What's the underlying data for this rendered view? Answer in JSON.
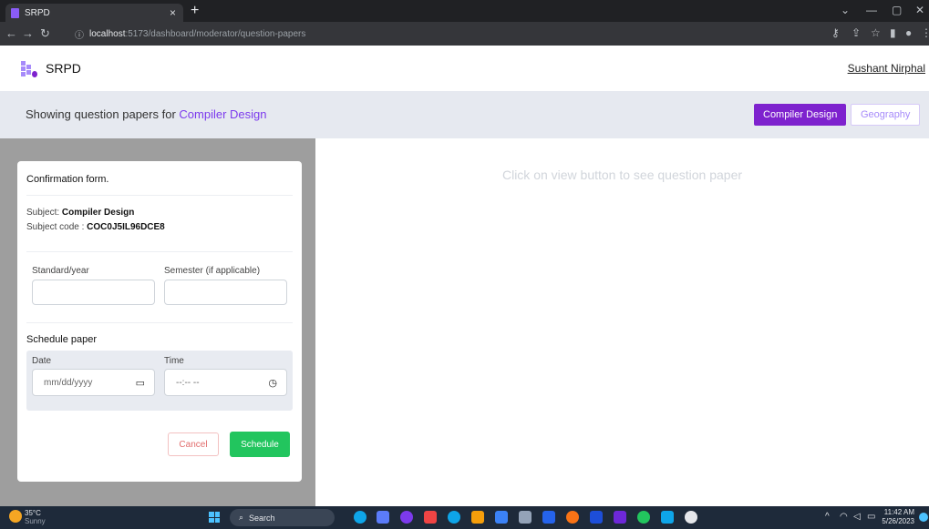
{
  "browser": {
    "tab_title": "SRPD",
    "tab_close": "×",
    "new_tab": "+",
    "url_host": "localhost",
    "url_rest": ":5173/dashboard/moderator/question-papers"
  },
  "app": {
    "brand": "SRPD",
    "user_name": "Sushant Nirphal"
  },
  "subject_bar": {
    "prefix": "Showing question papers for",
    "current_subject": "Compiler Design",
    "subjects": [
      "Compiler Design",
      "Geography"
    ]
  },
  "form": {
    "title": "Confirmation form.",
    "subject_label": "Subject:",
    "subject_value": "Compiler Design",
    "subject_code_label": "Subject code :",
    "subject_code_value": "COC0J5IL96DCE8",
    "standard_label": "Standard/year",
    "semester_label": "Semester (if applicable)",
    "schedule_title": "Schedule paper",
    "date_label": "Date",
    "date_placeholder": "mm/dd/yyyy",
    "time_label": "Time",
    "time_placeholder": "--:-- --",
    "cancel_label": "Cancel",
    "schedule_label": "Schedule"
  },
  "viewer": {
    "message": "Click on view button to see question paper"
  },
  "taskbar": {
    "temp": "35°C",
    "condition": "Sunny",
    "search_label": "Search",
    "time": "11:42 AM",
    "date": "5/26/2023"
  },
  "colors": {
    "accent": "#7e22ce",
    "success": "#22c55e",
    "danger": "#e26d6d"
  }
}
